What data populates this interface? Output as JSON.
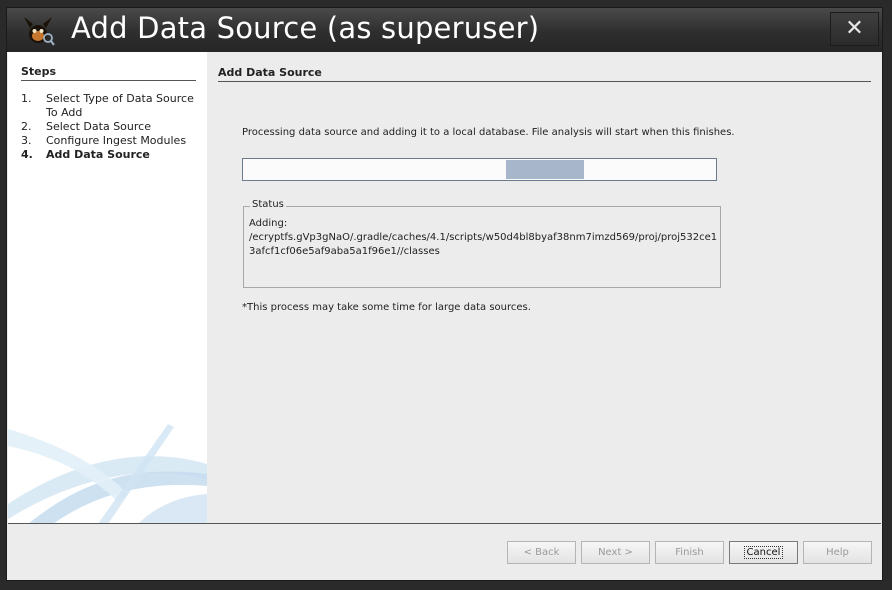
{
  "window": {
    "title": "Add Data Source (as superuser)"
  },
  "steps": {
    "title": "Steps",
    "items": [
      {
        "num": "1.",
        "label": "Select Type of Data Source To Add"
      },
      {
        "num": "2.",
        "label": "Select Data Source"
      },
      {
        "num": "3.",
        "label": "Configure Ingest Modules"
      },
      {
        "num": "4.",
        "label": "Add Data Source"
      }
    ]
  },
  "main": {
    "section_title": "Add Data Source",
    "processing_text": "Processing data source and adding it to a local database. File analysis will start when this finishes.",
    "progress": {
      "indeterminate": true,
      "indicator_start": 0.555,
      "indicator_end": 0.72
    },
    "status": {
      "legend": "Status",
      "line1": "Adding:",
      "path": "/ecryptfs.gVp3gNaO/.gradle/caches/4.1/scripts/w50d4bl8byaf38nm7imzd569/proj/proj532ce13afcf1cf06e5af9aba5a1f96e1//classes"
    },
    "note": "*This process may take some time for large data sources."
  },
  "footer": {
    "back": "< Back",
    "next": "Next >",
    "finish": "Finish",
    "cancel": "Cancel",
    "help": "Help"
  },
  "colors": {
    "progress_fill": "#a7b6ca",
    "titlebar": "#2e2e2e"
  }
}
